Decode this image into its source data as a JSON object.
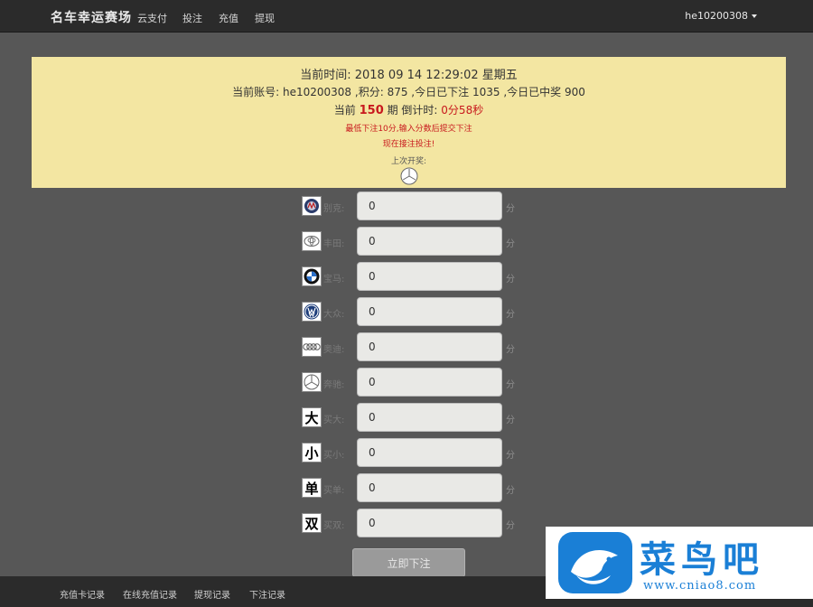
{
  "nav": {
    "brand": "名车幸运赛场",
    "links": [
      "云支付",
      "投注",
      "充值",
      "提现"
    ],
    "user": "he10200308"
  },
  "info": {
    "time_label": "当前时间:",
    "time_value": "2018 09 14 12:29:02 星期五",
    "account_label": "当前账号:",
    "account_value": "he10200308",
    "points_label": ",积分:",
    "points_value": "875",
    "today_bet_label": ",今日已下注",
    "today_bet_value": "1035",
    "today_win_label": ",今日已中奖",
    "today_win_value": "900",
    "period_prefix": "当前",
    "period_number": "150",
    "period_suffix": "期 倒计时:",
    "countdown": "0分58秒",
    "min_bet_text": "最低下注10分,输入分数后提交下注",
    "warning_text": "现在接注投注!",
    "last_result_label": "上次开奖:",
    "last_result_icon": "mercedes-logo-icon"
  },
  "bets": [
    {
      "brand_icon": "buick-logo-icon",
      "label": "别克:",
      "value": "0",
      "unit": "分"
    },
    {
      "brand_icon": "toyota-logo-icon",
      "label": "丰田:",
      "value": "0",
      "unit": "分"
    },
    {
      "brand_icon": "bmw-logo-icon",
      "label": "宝马:",
      "value": "0",
      "unit": "分"
    },
    {
      "brand_icon": "volkswagen-logo-icon",
      "label": "大众:",
      "value": "0",
      "unit": "分"
    },
    {
      "brand_icon": "audi-logo-icon",
      "label": "奥迪:",
      "value": "0",
      "unit": "分"
    },
    {
      "brand_icon": "mercedes-logo-icon",
      "label": "奔驰:",
      "value": "0",
      "unit": "分"
    },
    {
      "brand_icon": "big-char-icon",
      "glyph": "大",
      "label": "买大:",
      "value": "0",
      "unit": "分"
    },
    {
      "brand_icon": "small-char-icon",
      "glyph": "小",
      "label": "买小:",
      "value": "0",
      "unit": "分"
    },
    {
      "brand_icon": "single-char-icon",
      "glyph": "单",
      "label": "买单:",
      "value": "0",
      "unit": "分"
    },
    {
      "brand_icon": "double-char-icon",
      "glyph": "双",
      "label": "买双:",
      "value": "0",
      "unit": "分"
    }
  ],
  "submit_label": "立即下注",
  "footer": {
    "links": [
      "充值卡记录",
      "在线充值记录",
      "提现记录",
      "下注记录"
    ]
  },
  "watermark": {
    "text": "菜鸟吧",
    "url": "www.cniao8.com"
  },
  "colors": {
    "page_bg": "#575757",
    "navbar_bg": "#2b2b2b",
    "panel_bg": "#f3e6a2",
    "accent_red": "#c8191e",
    "watermark_blue": "#1a7fd6"
  }
}
